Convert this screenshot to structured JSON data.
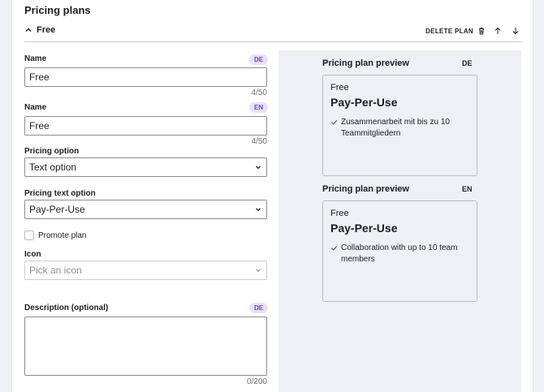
{
  "section": {
    "title": "Pricing plans"
  },
  "plan": {
    "name": "Free",
    "delete_label": "DELETE PLAN"
  },
  "form": {
    "name_de": {
      "label": "Name",
      "lang": "DE",
      "value": "Free",
      "counter": "4/50"
    },
    "name_en": {
      "label": "Name",
      "lang": "EN",
      "value": "Free",
      "counter": "4/50"
    },
    "pricing_option": {
      "label": "Pricing option",
      "value": "Text option"
    },
    "pricing_text_option": {
      "label": "Pricing text option",
      "value": "Pay-Per-Use"
    },
    "promote": {
      "label": "Promote plan",
      "checked": false
    },
    "icon": {
      "label": "Icon",
      "placeholder": "Pick an icon"
    },
    "description": {
      "label": "Description (optional)",
      "lang": "DE",
      "counter": "0/200"
    }
  },
  "previews": [
    {
      "title": "Pricing plan preview",
      "lang": "DE",
      "name": "Free",
      "price": "Pay-Per-Use",
      "feature": "Zusammenarbeit mit bis zu 10 Teammitgliedern"
    },
    {
      "title": "Pricing plan preview",
      "lang": "EN",
      "name": "Free",
      "price": "Pay-Per-Use",
      "feature": "Collaboration with up to 10 team members"
    }
  ],
  "colors": {
    "accent_badge_bg": "#e9e1fb",
    "accent_badge_text": "#6b3fc9"
  }
}
